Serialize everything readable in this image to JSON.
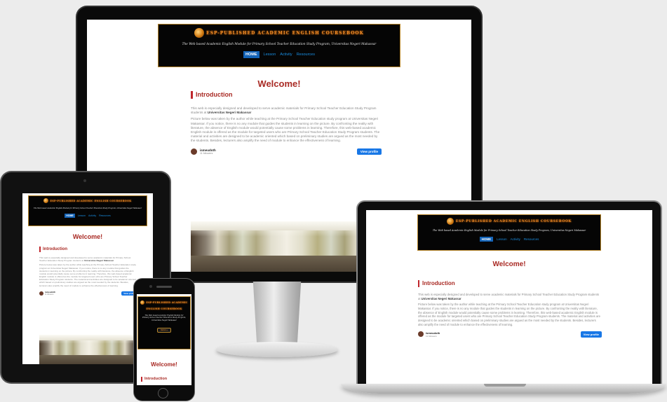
{
  "site": {
    "title": "ESP-PUBLISHED ACADEMIC ENGLISH COURSEBOOK",
    "subtitle": "The Web based Academic English Module for Primary School Teacher Education Study Program, Universitas Negeri Makassar",
    "nav": [
      "HOME",
      "Lesson",
      "Activity",
      "Resources"
    ],
    "welcome": "Welcome!",
    "section_heading": "Introduction",
    "para1_prefix": "This web is especially designed and developed to serve academic materials for Primary School Teacher Education Study Program students at ",
    "para1_bold": "Universitas Negeri Makassar",
    "para2": "Picture below was taken by the author while teaching at the Primary School Teacher Education study program at Universitas Negeri Makassar. If you notice, there is no any module that guides the students in learning on the picture. By confronting the reality with literature, the absence of English module would potentially cause some problems in learning. Therefore, this web-based academic English module is offered as the module for targeted users who are Primary School Teacher Education Study Program students. The material and activities are designed to be academic oriented which based on preliminary studies are argued as the most needed by the students. Besides, lecturers also amplify the need of module to enhance the effectiveness of learning.",
    "embed_user": "ismeudoth",
    "embed_followers": "11 followers",
    "view_profile": "View profile"
  },
  "phone": {
    "title_line1": "ESP-PUBLISHED ACADEMIC",
    "title_line2": "ENGLISH COURSEBOOK",
    "subtitle": "The Web based Academic English Module for Primary School Teacher Education Study Program, Universitas Negeri Makassar",
    "menu_label": "MENU ≡",
    "welcome": "Welcome!",
    "section_heading": "Introduction"
  }
}
